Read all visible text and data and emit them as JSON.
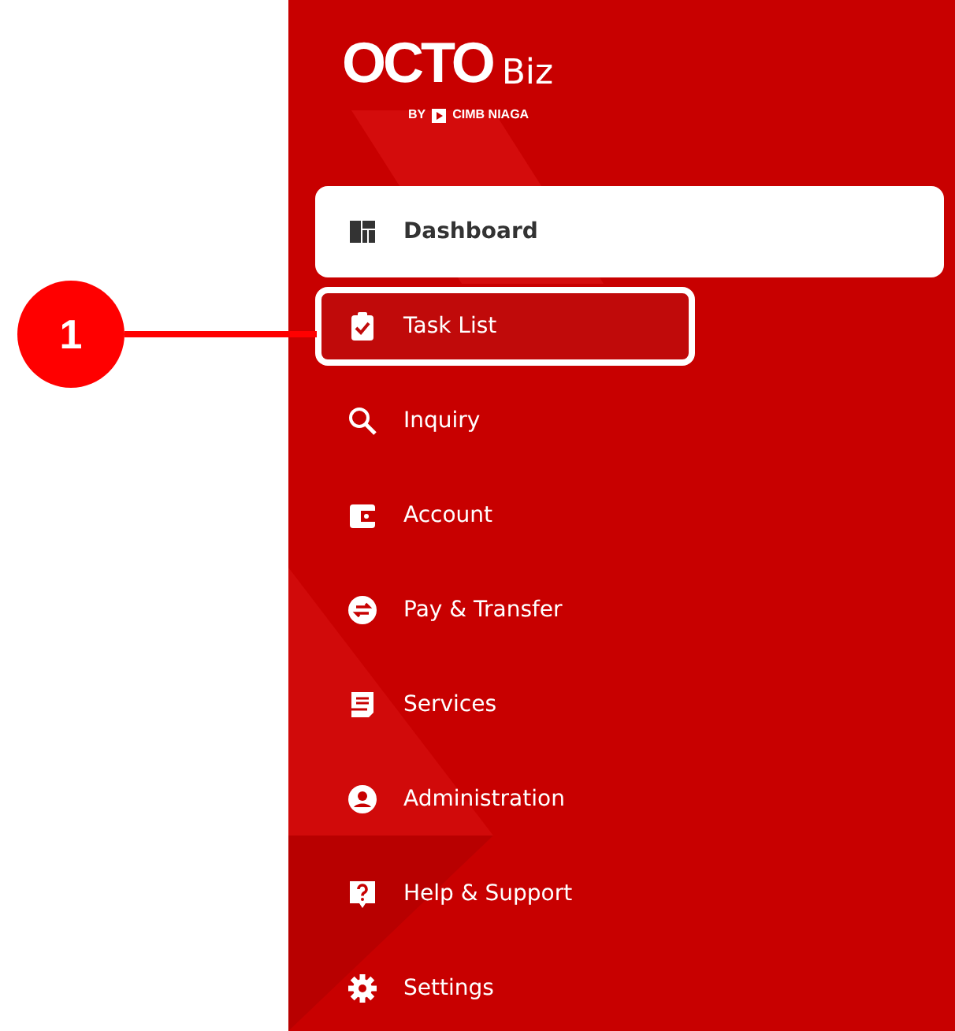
{
  "logo": {
    "brand": "OCTO",
    "suffix": "Biz",
    "by": "BY",
    "bank": "CIMB NIAGA"
  },
  "menu": [
    {
      "label": "Dashboard",
      "selected": true,
      "annotated": false
    },
    {
      "label": "Task List",
      "selected": false,
      "annotated": true
    },
    {
      "label": "Inquiry",
      "selected": false,
      "annotated": false
    },
    {
      "label": "Account",
      "selected": false,
      "annotated": false
    },
    {
      "label": "Pay & Transfer",
      "selected": false,
      "annotated": false
    },
    {
      "label": "Services",
      "selected": false,
      "annotated": false
    },
    {
      "label": "Administration",
      "selected": false,
      "annotated": false
    },
    {
      "label": "Help & Support",
      "selected": false,
      "annotated": false
    },
    {
      "label": "Settings",
      "selected": false,
      "annotated": false
    }
  ],
  "callout": {
    "number": "1"
  }
}
